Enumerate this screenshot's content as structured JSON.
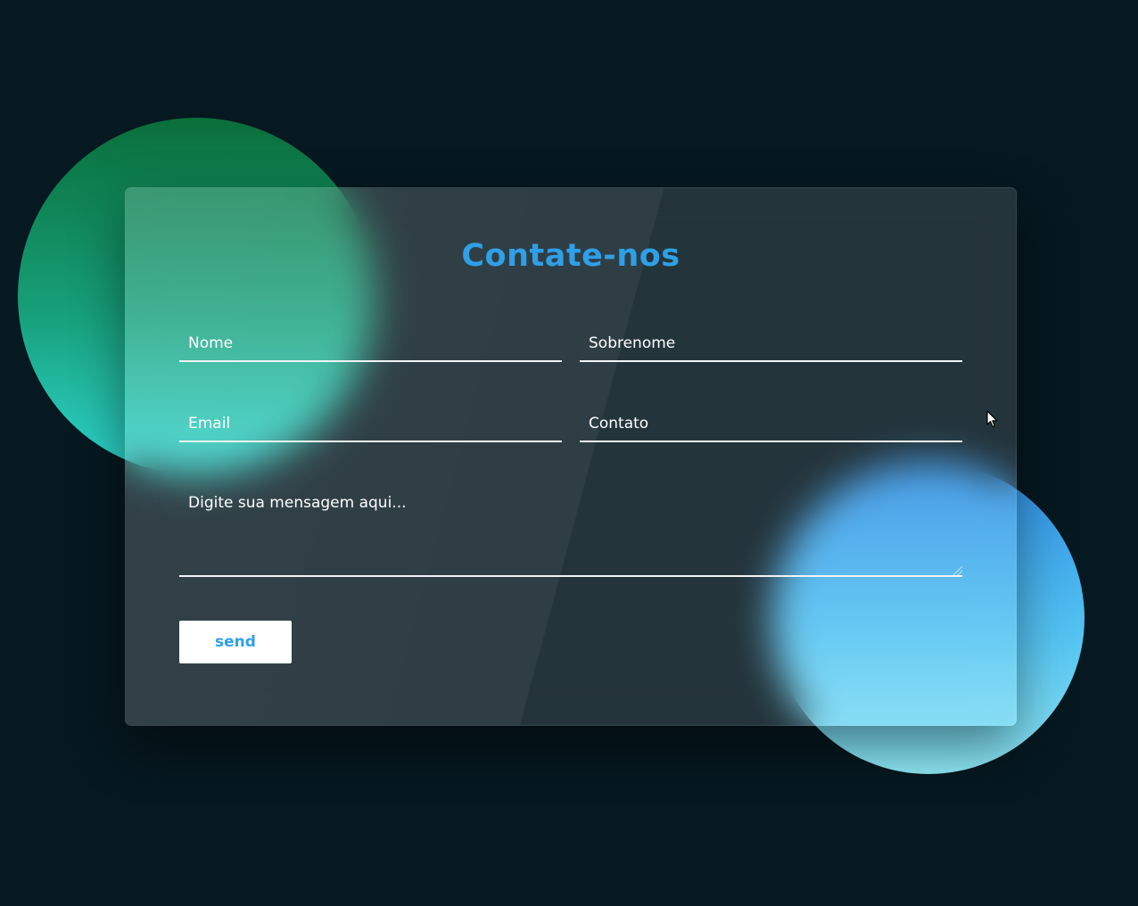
{
  "form": {
    "title": "Contate-nos",
    "fields": {
      "nome_placeholder": "Nome",
      "sobrenome_placeholder": "Sobrenome",
      "email_placeholder": "Email",
      "contato_placeholder": "Contato",
      "mensagem_placeholder": "Digite sua mensagem aqui..."
    },
    "submit_label": "send"
  },
  "colors": {
    "background": "#061820",
    "accent": "#2f9fe7",
    "circle_green": "#17a07a",
    "circle_blue": "#53c3f2",
    "input_text": "#ffffff"
  },
  "icons": {
    "cursor": "mouse-pointer-icon"
  }
}
